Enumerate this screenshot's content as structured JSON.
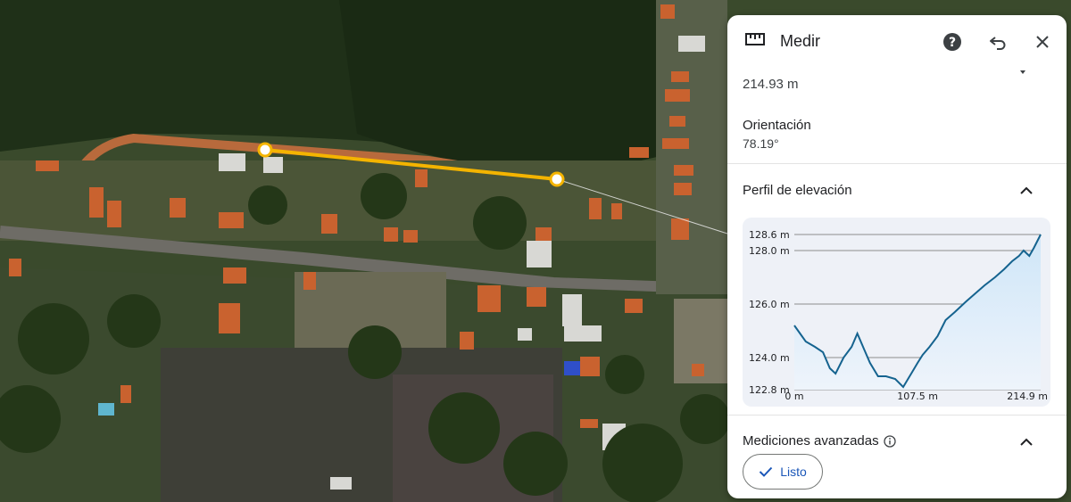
{
  "panel": {
    "title": "Medir",
    "distance_value": "214.93 m",
    "orientation_label": "Orientación",
    "orientation_value": "78.19°",
    "elevation_section_title": "Perfil de elevación",
    "advanced_section_title": "Mediciones avanzadas",
    "done_label": "Listo",
    "icons": [
      "ruler-icon",
      "help-icon",
      "undo-icon",
      "close-icon",
      "chevron-up-icon",
      "info-icon",
      "check-icon"
    ]
  },
  "colors": {
    "measure_line": "#f4b400",
    "profile_line": "#15638f",
    "profile_fill": "#cfe6f8",
    "accent": "#1a56b8"
  },
  "chart_data": {
    "type": "area",
    "title": "",
    "xlabel": "",
    "ylabel": "",
    "x_tick_labels": [
      "0 m",
      "107.5 m",
      "214.9 m"
    ],
    "y_tick_labels": [
      "128.6 m",
      "128.0 m",
      "126.0 m",
      "124.0 m",
      "122.8 m"
    ],
    "xlim": [
      0,
      214.9
    ],
    "ylim": [
      122.8,
      128.6
    ],
    "grid": true,
    "series": [
      {
        "x": [
          0,
          5,
          10,
          18,
          25,
          31,
          36,
          43,
          50,
          55,
          61,
          66,
          73,
          80,
          88,
          95,
          102,
          107.5,
          112,
          118,
          125,
          132,
          140,
          145,
          150,
          158,
          166,
          175,
          183,
          190,
          196,
          200,
          205,
          209,
          214.9
        ],
        "y": [
          125.2,
          124.9,
          124.6,
          124.4,
          124.2,
          123.6,
          123.4,
          124.0,
          124.4,
          124.9,
          124.3,
          123.8,
          123.3,
          123.3,
          123.2,
          122.9,
          123.4,
          123.8,
          124.1,
          124.4,
          124.8,
          125.4,
          125.7,
          125.9,
          126.1,
          126.4,
          126.7,
          127.0,
          127.3,
          127.6,
          127.8,
          128.0,
          127.8,
          128.1,
          128.6
        ]
      }
    ]
  }
}
